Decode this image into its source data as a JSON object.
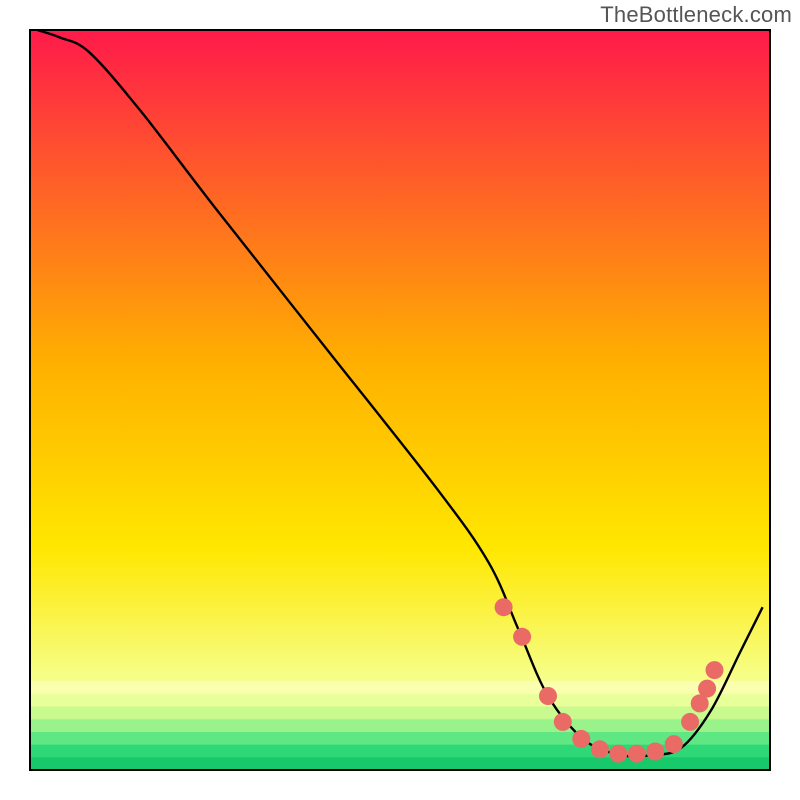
{
  "attribution": "TheBottleneck.com",
  "colors": {
    "text": "#555558",
    "curve": "#000000",
    "marker_fill": "#ea6a66",
    "marker_stroke": "#d95550",
    "plot_border": "#000000",
    "gradient_top": "#ff1a4a",
    "gradient_mid": "#ffd400",
    "gradient_low": "#f6ff8c",
    "gradient_green": "#1ee07a",
    "gradient_bottom": "#17c96b"
  },
  "chart_data": {
    "type": "line",
    "title": "",
    "xlabel": "",
    "ylabel": "",
    "xlim": [
      0,
      100
    ],
    "ylim": [
      0,
      100
    ],
    "grid": false,
    "legend": false,
    "series": [
      {
        "name": "curve",
        "x": [
          1,
          4,
          8,
          15,
          25,
          40,
          55,
          62,
          66,
          70,
          75,
          80,
          84,
          88,
          92,
          96,
          99
        ],
        "y": [
          100,
          99,
          97,
          89,
          76,
          57,
          38,
          28,
          19,
          10,
          4,
          2,
          2,
          3,
          8,
          16,
          22
        ]
      }
    ],
    "markers": {
      "name": "highlight-dots",
      "x": [
        64,
        66.5,
        70,
        72,
        74.5,
        77,
        79.5,
        82,
        84.5,
        87,
        89.2,
        90.5,
        91.5,
        92.5
      ],
      "y": [
        22,
        18,
        10,
        6.5,
        4.2,
        2.8,
        2.2,
        2.2,
        2.5,
        3.5,
        6.5,
        9,
        11,
        13.5
      ]
    }
  }
}
